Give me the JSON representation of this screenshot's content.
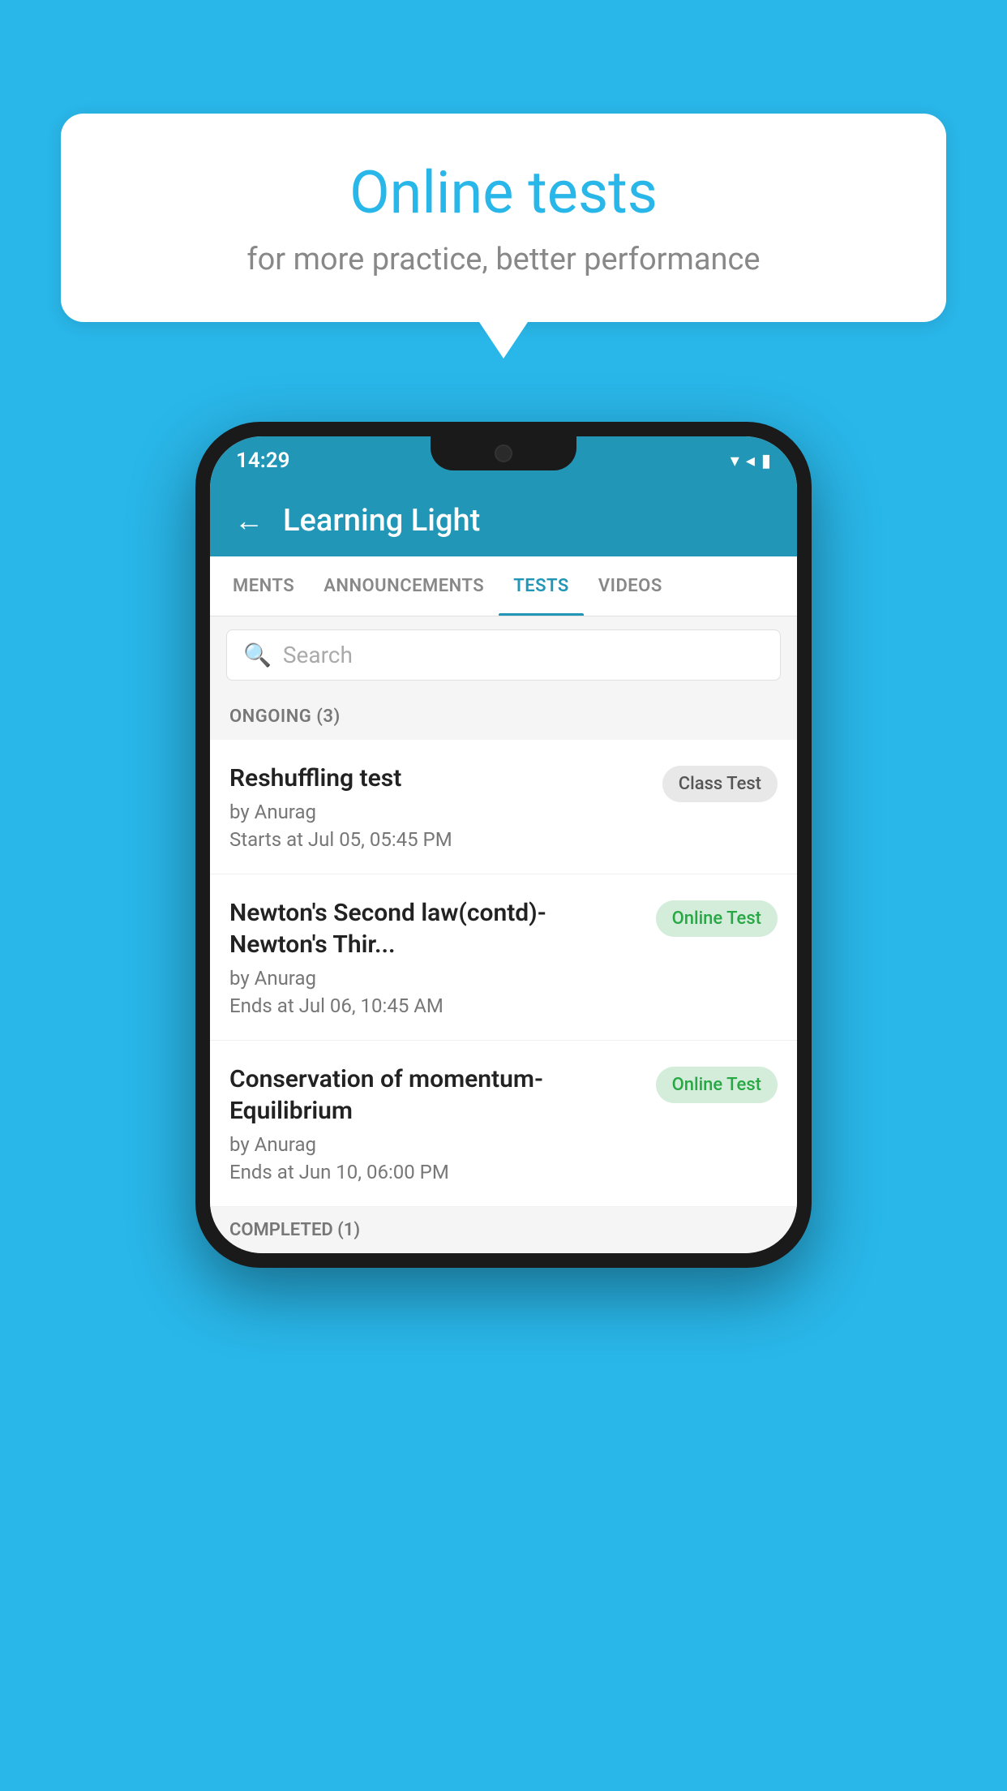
{
  "background": {
    "color": "#29B6E8"
  },
  "speech_bubble": {
    "title": "Online tests",
    "subtitle": "for more practice, better performance"
  },
  "status_bar": {
    "time": "14:29",
    "icons": [
      "wifi",
      "signal",
      "battery"
    ]
  },
  "app_header": {
    "title": "Learning Light",
    "back_label": "←"
  },
  "tabs": [
    {
      "label": "MENTS",
      "active": false
    },
    {
      "label": "ANNOUNCEMENTS",
      "active": false
    },
    {
      "label": "TESTS",
      "active": true
    },
    {
      "label": "VIDEOS",
      "active": false
    }
  ],
  "search": {
    "placeholder": "Search"
  },
  "ongoing": {
    "header": "ONGOING (3)",
    "items": [
      {
        "name": "Reshuffling test",
        "author": "by Anurag",
        "date": "Starts at  Jul 05, 05:45 PM",
        "badge": "Class Test",
        "badge_type": "class"
      },
      {
        "name": "Newton's Second law(contd)-Newton's Thir...",
        "author": "by Anurag",
        "date": "Ends at  Jul 06, 10:45 AM",
        "badge": "Online Test",
        "badge_type": "online"
      },
      {
        "name": "Conservation of momentum-Equilibrium",
        "author": "by Anurag",
        "date": "Ends at  Jun 10, 06:00 PM",
        "badge": "Online Test",
        "badge_type": "online"
      }
    ]
  },
  "completed": {
    "header": "COMPLETED (1)"
  }
}
